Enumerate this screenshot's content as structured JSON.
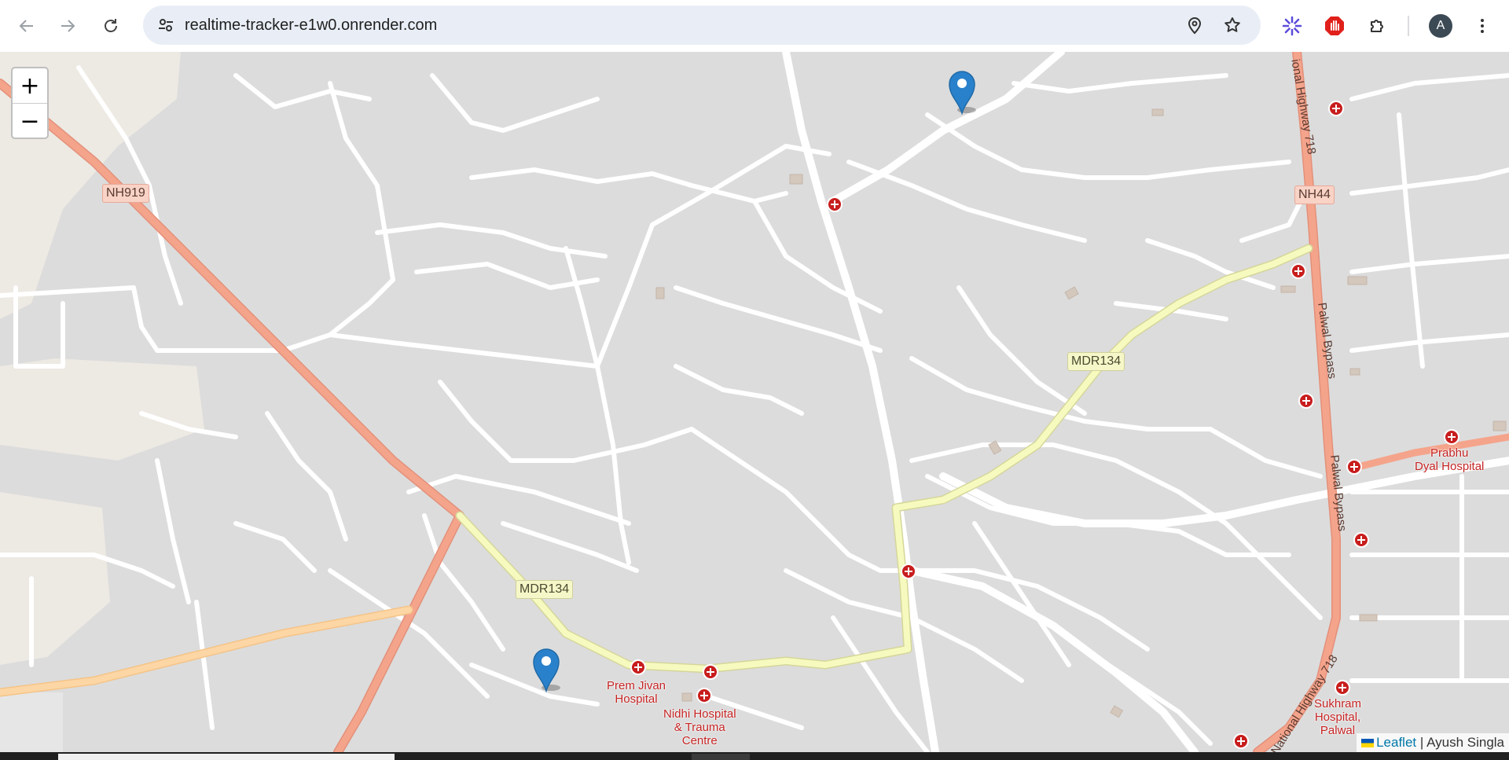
{
  "browser": {
    "url": "realtime-tracker-e1w0.onrender.com",
    "profile_initial": "A",
    "icons": [
      "back-icon",
      "forward-icon",
      "reload-icon",
      "site-settings-icon",
      "location-icon",
      "bookmark-star-icon",
      "extension-spark-icon",
      "extension-stop-icon",
      "extensions-puzzle-icon",
      "profile-avatar",
      "more-menu-icon"
    ]
  },
  "map": {
    "zoom": {
      "in_label": "+",
      "out_label": "−"
    },
    "road_shields": {
      "nh919": "NH919",
      "nh44": "NH44",
      "mdr134_east": "MDR134",
      "mdr134_west": "MDR134"
    },
    "road_names": {
      "nh718_top": "ional Highway 718",
      "palwal_bypass_1": "Palwal Bypass",
      "palwal_bypass_2": "Palwal Bypass",
      "nh718_bottom": "National Highway 718"
    },
    "places": {
      "prem_jivan": "Prem Jivan\nHospital",
      "nidhi": "Nidhi Hospital\n& Trauma\nCentre",
      "prabhu_dyal": "Prabhu\nDyal Hospital",
      "sukhram": "Sukhram\nHospital,\nPalwal"
    },
    "markers": [
      "tracked-user-marker",
      "tracked-user-marker"
    ],
    "attribution": {
      "leaflet": "Leaflet",
      "separator": " | ",
      "author": "Ayush Singla"
    },
    "colors": {
      "map_background": "#dcdcdc",
      "trunk_road": "#f5a48c",
      "primary_road": "#fcd6a4",
      "secondary_road": "#f7fabf",
      "marker": "#2a81cb",
      "hospital": "#c81d1d"
    }
  }
}
